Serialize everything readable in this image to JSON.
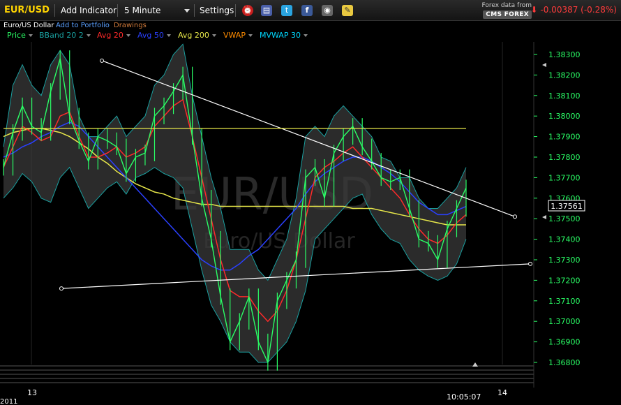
{
  "toolbar": {
    "symbol": "EUR/USD",
    "add_indicator": "Add Indicator",
    "interval": "5 Minute",
    "settings": "Settings"
  },
  "source": {
    "line1": "Forex data from",
    "brand": "CMS FOREX"
  },
  "change": {
    "text": "-0.00387 (-0.28%)",
    "color": "#ff3b3b"
  },
  "subbar": {
    "name": "Euro/US Dollar",
    "add_portfolio": "Add to Portfolio",
    "drawings": "Drawings"
  },
  "legend": [
    {
      "label": "Price",
      "color": "#2aff66"
    },
    {
      "label": "BBand 20 2",
      "color": "#1aa0a0"
    },
    {
      "label": "Avg 20",
      "color": "#ff2a2a"
    },
    {
      "label": "Avg 50",
      "color": "#2a40ff"
    },
    {
      "label": "Avg 200",
      "color": "#e8e84a"
    },
    {
      "label": "VWAP",
      "color": "#ff8c00"
    },
    {
      "label": "MVWAP 30",
      "color": "#00d8ff"
    }
  ],
  "watermark": {
    "symbol": "EUR/USD",
    "name": "Euro/US Dollar"
  },
  "chart_data": {
    "type": "line",
    "ylim": [
      1.3675,
      1.3835
    ],
    "y_ticks": [
      1.383,
      1.382,
      1.381,
      1.38,
      1.379,
      1.378,
      1.377,
      1.376,
      1.375,
      1.374,
      1.373,
      1.372,
      1.371,
      1.37,
      1.369,
      1.368
    ],
    "y_tick_labels": [
      "1.38300",
      "1.38200",
      "1.38100",
      "1.38000",
      "1.37900",
      "1.37800",
      "1.37700",
      "1.37600",
      "1.37500",
      "1.37400",
      "1.37300",
      "1.37200",
      "1.37100",
      "1.37000",
      "1.36900",
      "1.36800"
    ],
    "x_labels": [
      "13",
      "10:05:07",
      "14"
    ],
    "year_label": "2011",
    "last_price": "1.37561",
    "series": [
      {
        "name": "Price",
        "color": "#2aff66",
        "y": [
          1.3775,
          1.3792,
          1.3805,
          1.3795,
          1.3792,
          1.3812,
          1.3828,
          1.38,
          1.3788,
          1.3778,
          1.379,
          1.3788,
          1.3785,
          1.3772,
          1.378,
          1.3782,
          1.38,
          1.3805,
          1.3812,
          1.382,
          1.379,
          1.376,
          1.374,
          1.3712,
          1.369,
          1.37,
          1.3712,
          1.369,
          1.368,
          1.371,
          1.372,
          1.373,
          1.377,
          1.3775,
          1.376,
          1.3782,
          1.379,
          1.3795,
          1.3785,
          1.3778,
          1.377,
          1.3768,
          1.377,
          1.3755,
          1.374,
          1.3738,
          1.373,
          1.3745,
          1.3755,
          1.3765
        ]
      },
      {
        "name": "BBand 20 2",
        "color": "#1aa0a0",
        "upper": [
          1.3785,
          1.3815,
          1.3825,
          1.3815,
          1.381,
          1.3825,
          1.3832,
          1.3825,
          1.38,
          1.379,
          1.379,
          1.3795,
          1.38,
          1.379,
          1.3795,
          1.38,
          1.3815,
          1.382,
          1.383,
          1.3835,
          1.381,
          1.379,
          1.377,
          1.3755,
          1.3735,
          1.3735,
          1.3735,
          1.3725,
          1.372,
          1.373,
          1.374,
          1.376,
          1.379,
          1.3795,
          1.379,
          1.38,
          1.3805,
          1.38,
          1.3795,
          1.379,
          1.378,
          1.3778,
          1.377,
          1.377,
          1.376,
          1.3755,
          1.3755,
          1.376,
          1.3765,
          1.3775
        ],
        "lower": [
          1.376,
          1.3765,
          1.3772,
          1.3768,
          1.376,
          1.3758,
          1.377,
          1.3775,
          1.3765,
          1.3755,
          1.376,
          1.3765,
          1.3768,
          1.3762,
          1.377,
          1.3772,
          1.3775,
          1.3772,
          1.377,
          1.3765,
          1.3745,
          1.3725,
          1.3708,
          1.37,
          1.369,
          1.3685,
          1.3685,
          1.368,
          1.368,
          1.3685,
          1.369,
          1.37,
          1.3715,
          1.374,
          1.3745,
          1.375,
          1.3755,
          1.376,
          1.3762,
          1.3752,
          1.3745,
          1.374,
          1.3738,
          1.373,
          1.3725,
          1.3722,
          1.372,
          1.3722,
          1.3728,
          1.374
        ]
      },
      {
        "name": "Avg 20",
        "color": "#ff2a2a",
        "y": [
          1.3775,
          1.3785,
          1.3795,
          1.3792,
          1.3788,
          1.379,
          1.38,
          1.3802,
          1.379,
          1.378,
          1.378,
          1.3782,
          1.3785,
          1.378,
          1.3782,
          1.3785,
          1.3795,
          1.38,
          1.3805,
          1.3808,
          1.379,
          1.377,
          1.375,
          1.373,
          1.3715,
          1.3712,
          1.3712,
          1.3705,
          1.37,
          1.3705,
          1.3715,
          1.373,
          1.375,
          1.377,
          1.3775,
          1.3778,
          1.3782,
          1.3785,
          1.378,
          1.3775,
          1.377,
          1.3765,
          1.376,
          1.3752,
          1.3745,
          1.374,
          1.3738,
          1.3742,
          1.3748,
          1.3752
        ]
      },
      {
        "name": "Avg 50",
        "color": "#2a40ff",
        "y": [
          1.378,
          1.3782,
          1.3785,
          1.3787,
          1.379,
          1.3792,
          1.3795,
          1.3797,
          1.3795,
          1.379,
          1.3785,
          1.378,
          1.3775,
          1.377,
          1.3765,
          1.376,
          1.3755,
          1.375,
          1.3745,
          1.374,
          1.3735,
          1.373,
          1.3727,
          1.3725,
          1.3725,
          1.3728,
          1.3732,
          1.3735,
          1.374,
          1.3745,
          1.375,
          1.3755,
          1.3762,
          1.3768,
          1.3772,
          1.3775,
          1.3778,
          1.378,
          1.378,
          1.3778,
          1.3775,
          1.3772,
          1.3768,
          1.3763,
          1.3758,
          1.3755,
          1.3752,
          1.3752,
          1.3754,
          1.3756
        ]
      },
      {
        "name": "Avg 200",
        "color": "#e8e84a",
        "y": [
          1.379,
          1.3792,
          1.3793,
          1.3794,
          1.3794,
          1.3793,
          1.3792,
          1.379,
          1.3787,
          1.3784,
          1.378,
          1.3777,
          1.3773,
          1.377,
          1.3767,
          1.3765,
          1.3763,
          1.3762,
          1.376,
          1.3759,
          1.3758,
          1.3757,
          1.3757,
          1.3756,
          1.3756,
          1.3756,
          1.3756,
          1.3756,
          1.3756,
          1.3756,
          1.3756,
          1.3756,
          1.3756,
          1.3756,
          1.3756,
          1.3756,
          1.3756,
          1.3755,
          1.3755,
          1.3755,
          1.3754,
          1.3753,
          1.3752,
          1.3751,
          1.375,
          1.3749,
          1.3748,
          1.3747,
          1.3747,
          1.3747
        ]
      }
    ],
    "trendlines": [
      {
        "color": "#ffffff",
        "points": [
          [
            "13",
            1.3827
          ],
          [
            "14",
            1.3751
          ]
        ]
      },
      {
        "color": "#ffffff",
        "points": [
          [
            "13",
            1.3716
          ],
          [
            "14",
            1.3728
          ]
        ]
      },
      {
        "color": "#e8e84a",
        "y": 1.3794
      }
    ]
  }
}
